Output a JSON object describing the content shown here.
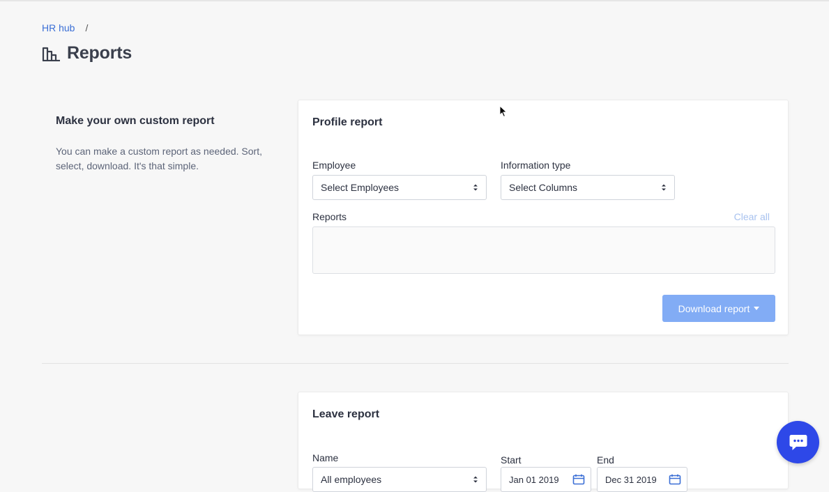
{
  "breadcrumb": {
    "link": "HR hub",
    "separator": "/"
  },
  "page": {
    "title": "Reports",
    "icon": "bar-chart-icon"
  },
  "intro": {
    "title": "Make your own custom report",
    "description": "You can make a custom report as needed. Sort, select, download. It's that simple."
  },
  "profile_report": {
    "title": "Profile report",
    "employee_label": "Employee",
    "employee_value": "Select Employees",
    "info_type_label": "Information type",
    "info_type_value": "Select Columns",
    "reports_label": "Reports",
    "clear_all": "Clear all",
    "download_label": "Download report"
  },
  "leave_report": {
    "title": "Leave report",
    "name_label": "Name",
    "name_value": "All employees",
    "start_label": "Start",
    "start_value": "Jan 01 2019",
    "end_label": "End",
    "end_value": "Dec 31 2019"
  },
  "colors": {
    "accent": "#3b6fd6",
    "button": "#82acf5",
    "chat": "#2e48e8"
  }
}
